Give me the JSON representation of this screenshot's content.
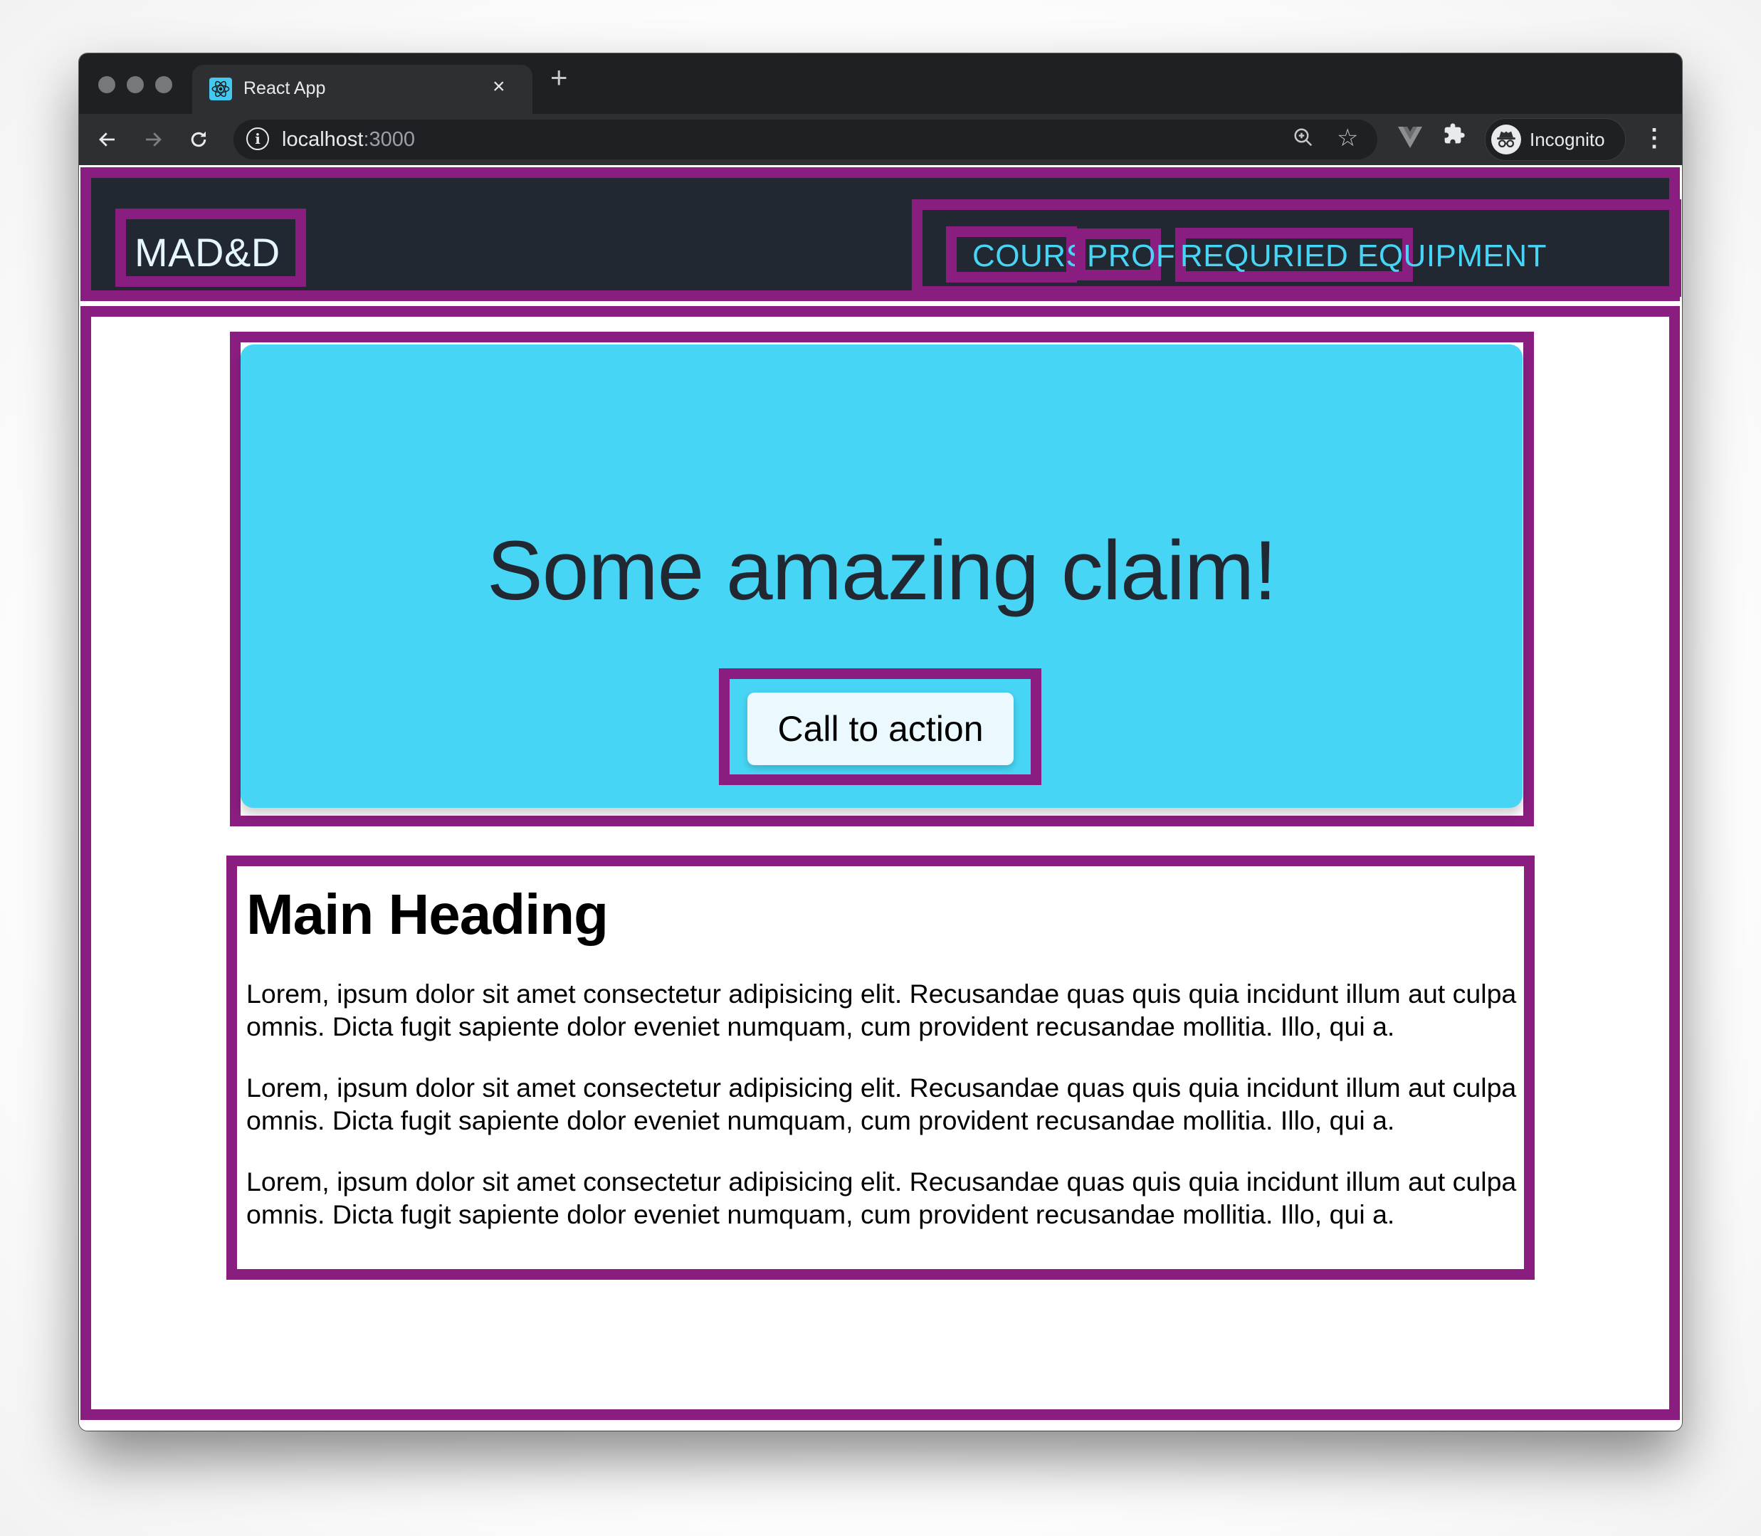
{
  "browser": {
    "tab": {
      "title": "React App",
      "favicon": "react-logo-icon",
      "close_label": "×"
    },
    "new_tab_label": "+",
    "nav": {
      "back": "←",
      "forward": "→",
      "reload": "↻"
    },
    "address": {
      "host": "localhost",
      "port": ":3000"
    },
    "profile": {
      "label": "Incognito"
    },
    "icons": [
      "info-icon",
      "zoom-icon",
      "star-icon",
      "vue-devtools-icon",
      "extensions-icon",
      "incognito-icon",
      "menu-icon"
    ]
  },
  "header": {
    "logo": "MAD&D",
    "nav_items": [
      {
        "label": "COURSES"
      },
      {
        "label": "PROFS"
      },
      {
        "label": "REQURIED EQUIPMENT"
      }
    ]
  },
  "hero": {
    "title": "Some amazing claim!",
    "cta_label": "Call to action"
  },
  "content": {
    "heading": "Main Heading",
    "paragraphs": [
      "Lorem, ipsum dolor sit amet consectetur adipisicing elit. Recusandae quas quis quia incidunt illum aut culpa omnis. Dicta fugit sapiente dolor eveniet numquam, cum provident recusandae mollitia. Illo, qui a.",
      "Lorem, ipsum dolor sit amet consectetur adipisicing elit. Recusandae quas quis quia incidunt illum aut culpa omnis. Dicta fugit sapiente dolor eveniet numquam, cum provident recusandae mollitia. Illo, qui a.",
      "Lorem, ipsum dolor sit amet consectetur adipisicing elit. Recusandae quas quis quia incidunt illum aut culpa omnis. Dicta fugit sapiente dolor eveniet numquam, cum provident recusandae mollitia. Illo, qui a."
    ]
  },
  "colors": {
    "debug_outline": "#8a1e80",
    "header_bg": "#222831",
    "accent": "#47d5f6",
    "logo_text": "#e6f6ff",
    "cta_bg": "#ebf9fe"
  }
}
